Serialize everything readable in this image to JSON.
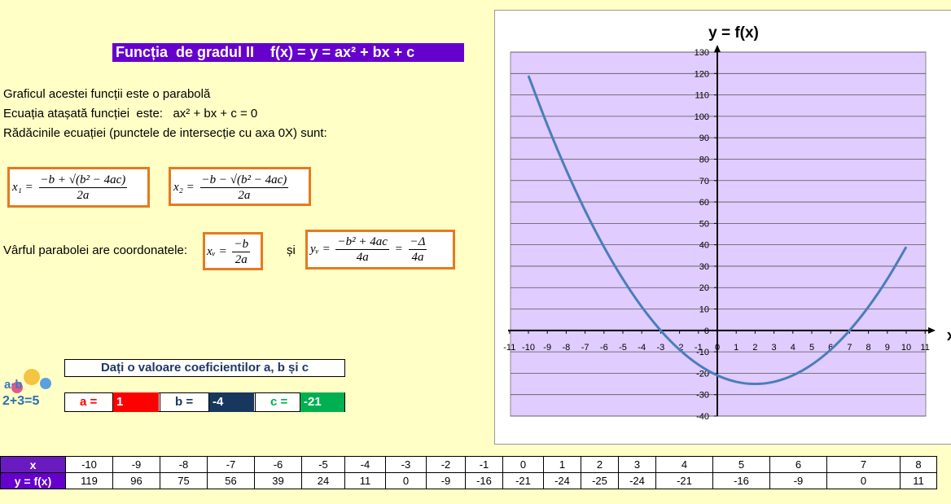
{
  "title": "Funcția  de gradul II    f(x) = y = ax² + bx + c",
  "text": {
    "line1": "Graficul acestei funcții este o parabolă",
    "line2": "Ecuația atașată funcției  este:   ax² + bx + c = 0",
    "line3": "Rădăcinile ecuației (punctele de intersecție cu axa 0X) sunt:",
    "vertex_label": "Vârful parabolei are coordonatele:",
    "and": "și"
  },
  "formulas": {
    "x1_lhs": "x₁ =",
    "x1_num": "−b + √(b² − 4ac)",
    "x1_den": "2a",
    "x2_lhs": "x₂ =",
    "x2_num": "−b − √(b² − 4ac)",
    "x2_den": "2a",
    "xv_lhs": "xᵥ =",
    "xv_num": "−b",
    "xv_den": "2a",
    "yv_lhs": "yᵥ =",
    "yv_num": "−b² + 4ac",
    "yv_den": "4a",
    "yv_eq": "=",
    "yv_num2": "−Δ",
    "yv_den2": "4a"
  },
  "coef": {
    "header": "Dați o valoare coeficientilor a, b și c",
    "a_label": "a =",
    "a_value": "1",
    "b_label": "b =",
    "b_value": "-4",
    "c_label": "c =",
    "c_value": "-21",
    "colors": {
      "a": "#ff0000",
      "b": "#17375e",
      "c": "#00b050"
    }
  },
  "chart_data": {
    "type": "line",
    "title": "y = f(x)",
    "xlabel": "x",
    "ylabel": "",
    "xlim": [
      -11,
      11
    ],
    "ylim": [
      -40,
      130
    ],
    "x_ticks": [
      -11,
      -10,
      -9,
      -8,
      -7,
      -6,
      -5,
      -4,
      -3,
      -2,
      -1,
      0,
      1,
      2,
      3,
      4,
      5,
      6,
      7,
      8,
      9,
      10,
      11
    ],
    "y_ticks": [
      -40,
      -30,
      -20,
      -10,
      0,
      10,
      20,
      30,
      40,
      50,
      60,
      70,
      80,
      90,
      100,
      110,
      120,
      130
    ],
    "grid": "horizontal",
    "plot_bg": "#e0ccff",
    "line_color": "#4a7ebb",
    "series": [
      {
        "x": [
          -10,
          -9,
          -8,
          -7,
          -6,
          -5,
          -4,
          -3,
          -2,
          -1,
          0,
          1,
          2,
          3,
          4,
          5,
          6,
          7,
          8,
          9,
          10
        ],
        "y": [
          119,
          96,
          75,
          56,
          39,
          24,
          11,
          0,
          -9,
          -16,
          -21,
          -24,
          -25,
          -24,
          -21,
          -16,
          -9,
          0,
          11,
          24,
          39
        ]
      }
    ]
  },
  "table": {
    "row_x_label": "x",
    "row_y_label": "y = f(x)",
    "x": [
      "-10",
      "-9",
      "-8",
      "-7",
      "-6",
      "-5",
      "-4",
      "-3",
      "-2",
      "-1",
      "0",
      "1",
      "2",
      "3",
      "4",
      "5",
      "6",
      "7",
      "8"
    ],
    "y": [
      "119",
      "96",
      "75",
      "56",
      "39",
      "24",
      "11",
      "0",
      "-9",
      "-16",
      "-21",
      "-24",
      "-25",
      "-24",
      "-21",
      "-16",
      "-9",
      "0",
      "11"
    ]
  }
}
